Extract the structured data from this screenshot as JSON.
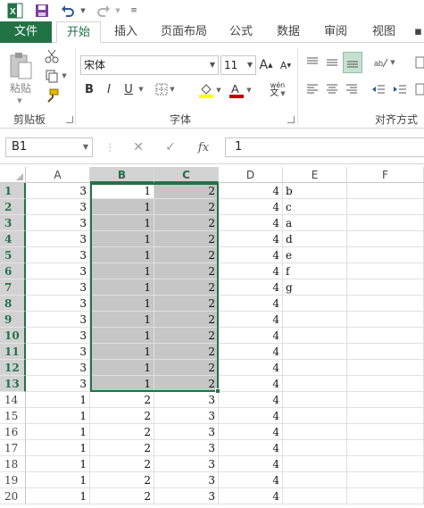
{
  "qat": {
    "icons": [
      "excel-logo-icon",
      "save-icon",
      "undo-icon",
      "redo-icon",
      "customize-qat-icon"
    ]
  },
  "tabs": [
    "文件",
    "开始",
    "插入",
    "页面布局",
    "公式",
    "数据",
    "审阅",
    "视图"
  ],
  "ribbon": {
    "clipboard": {
      "paste_label": "粘贴",
      "group_label": "剪贴板"
    },
    "font": {
      "font_name": "宋体",
      "font_size": "11",
      "bold": "B",
      "italic": "I",
      "underline": "U",
      "phonetic": "wén",
      "group_label": "字体"
    },
    "alignment": {
      "group_label": "对齐方式"
    }
  },
  "formula_bar": {
    "name_box": "B1",
    "fx_label": "fx",
    "value": "1"
  },
  "columns": [
    "A",
    "B",
    "C",
    "D",
    "E",
    "F"
  ],
  "selected_columns": [
    "B",
    "C"
  ],
  "rows": [
    {
      "n": "1",
      "A": "3",
      "B": "1",
      "C": "2",
      "D": "4",
      "E": "b"
    },
    {
      "n": "2",
      "A": "3",
      "B": "1",
      "C": "2",
      "D": "4",
      "E": "c"
    },
    {
      "n": "3",
      "A": "3",
      "B": "1",
      "C": "2",
      "D": "4",
      "E": "a"
    },
    {
      "n": "4",
      "A": "3",
      "B": "1",
      "C": "2",
      "D": "4",
      "E": "d"
    },
    {
      "n": "5",
      "A": "3",
      "B": "1",
      "C": "2",
      "D": "4",
      "E": "e"
    },
    {
      "n": "6",
      "A": "3",
      "B": "1",
      "C": "2",
      "D": "4",
      "E": "f"
    },
    {
      "n": "7",
      "A": "3",
      "B": "1",
      "C": "2",
      "D": "4",
      "E": "g"
    },
    {
      "n": "8",
      "A": "3",
      "B": "1",
      "C": "2",
      "D": "4",
      "E": ""
    },
    {
      "n": "9",
      "A": "3",
      "B": "1",
      "C": "2",
      "D": "4",
      "E": ""
    },
    {
      "n": "10",
      "A": "3",
      "B": "1",
      "C": "2",
      "D": "4",
      "E": ""
    },
    {
      "n": "11",
      "A": "3",
      "B": "1",
      "C": "2",
      "D": "4",
      "E": ""
    },
    {
      "n": "12",
      "A": "3",
      "B": "1",
      "C": "2",
      "D": "4",
      "E": ""
    },
    {
      "n": "13",
      "A": "3",
      "B": "1",
      "C": "2",
      "D": "4",
      "E": ""
    },
    {
      "n": "14",
      "A": "1",
      "B": "2",
      "C": "3",
      "D": "4",
      "E": ""
    },
    {
      "n": "15",
      "A": "1",
      "B": "2",
      "C": "3",
      "D": "4",
      "E": ""
    },
    {
      "n": "16",
      "A": "1",
      "B": "2",
      "C": "3",
      "D": "4",
      "E": ""
    },
    {
      "n": "17",
      "A": "1",
      "B": "2",
      "C": "3",
      "D": "4",
      "E": ""
    },
    {
      "n": "18",
      "A": "1",
      "B": "2",
      "C": "3",
      "D": "4",
      "E": ""
    },
    {
      "n": "19",
      "A": "1",
      "B": "2",
      "C": "3",
      "D": "4",
      "E": ""
    },
    {
      "n": "20",
      "A": "1",
      "B": "2",
      "C": "3",
      "D": "4",
      "E": ""
    }
  ],
  "selection": {
    "range": "B1:C13",
    "active": "B1"
  },
  "colors": {
    "accent": "#217346",
    "selection_fill": "#c6c6c6"
  }
}
